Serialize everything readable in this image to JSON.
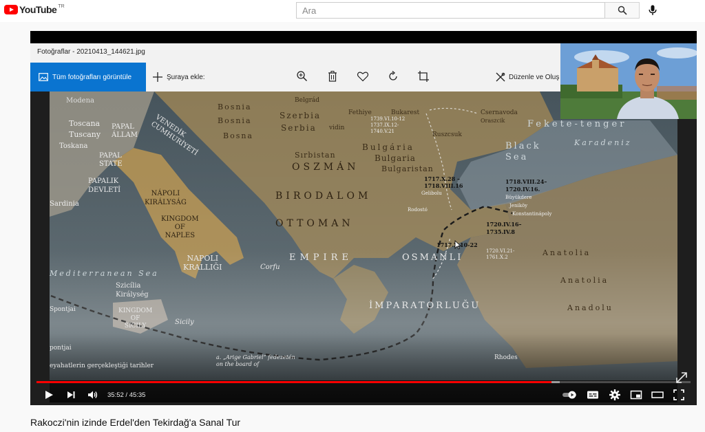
{
  "masthead": {
    "logo_text": "YouTube",
    "region": "TR",
    "search_placeholder": "Ara"
  },
  "photos_app": {
    "window_title": "Fotoğraflar - 20210413_144621.jpg",
    "all_photos_label": "Tüm fotoğrafları görüntüle",
    "add_to_label": "Şuraya ekle:",
    "edit_label": "Düzenle ve Oluş"
  },
  "map": {
    "labels": {
      "modena": "Modena",
      "toscana": "Toscana",
      "tuscany": "Tuscany",
      "toskana": "Toskana",
      "papal_allam": "PAPAL\nÁLLAM",
      "papal_state": "PAPAL\nSTATE",
      "papalik": "PAPALIK\nDEVLETİ",
      "sardinia": "Sardinia",
      "venedik": "VENEDİK\nCUMHURİYETİ",
      "bosnia1": "Bosnia",
      "bosnia2": "Bosnia",
      "bosna": "Bosna",
      "szerbia": "Szerbia",
      "serbia": "Serbia",
      "vidin": "vidin",
      "belgrad": "Belgrád",
      "fethiye": "Fethiye",
      "bukarest": "Bukarest",
      "csernavoda": "Csernavoda",
      "oraszcik": "Oraszcik",
      "ruszcsuk": "Ruszcsuk",
      "dates_top": "1739.VI.10-12\n1737.IX.12-\n1740.V.21",
      "bulgaria1": "Bulgária",
      "bulgaria2": "Bulgaria",
      "bulgaristan": "Bulgaristan",
      "sirbistan": "Sırbistan",
      "fekete": "Fekete-tenger",
      "karadeniz": "Karadeniz",
      "black_sea": "Black\nSea",
      "oszman": "OSZMÁN",
      "birodalom": "BIRODALOM",
      "ottoman": "OTTOMAN",
      "empire": "EMPIRE",
      "osmanli": "OSMANLI",
      "imparatorlugu": "İMPARATORLUĞU",
      "napoli_kir": "NÁPOLI\nKIRÁLYSÁG",
      "kingdom_naples": "KINGDOM\nOF\nNAPLES",
      "napoli_kral": "NAPOLI\nKRALLIĞI",
      "corfu": "Corfu",
      "date_a": "1717.X.28 –\n1718.VIII.16",
      "date_b": "1718.VIII.24–\n1720.IV.16.",
      "date_c": "1720.IV.16–\n1735.IV.8",
      "date_d": "1717.X.10-22",
      "date_e": "1720.VI.21-\n1761.X.2",
      "gelibolu": "Gelibolu",
      "rodosto": "Rodostó",
      "boukdere": "Büyükdere",
      "jenikoy": "Jeniköy",
      "konstantinapoly": "Konstantinápoly",
      "anatolia1": "Anatolia",
      "anatolia2": "Anatolia",
      "anadolu": "Anadolu",
      "mediterranean": "Mediterranean Sea",
      "szicilia": "Szicília\nKirálység",
      "kingdom_sicily": "KINGDOM\nOF\nSICILY",
      "sicily": "Sicily",
      "spontjai": "Spontjai",
      "pontjai": "pontjai",
      "route_note": "eyahatlerin gerçekleştiği tarihler",
      "arige": "a. „Arige Gabriel” fedezetén\non the board of",
      "rhodes": "Rhodes"
    }
  },
  "player": {
    "time_display": "35:52 / 45:35",
    "progress_played": 0.787,
    "progress_loaded": 0.8
  },
  "video": {
    "title": "Rakoczi'nin izinde Erdel'den Tekirdağ'a Sanal Tur"
  },
  "colors": {
    "brand_red": "#ff0000",
    "photos_accent": "#0a74d0",
    "map_sea": "#3c4a52",
    "map_land": "#8a7a55"
  }
}
